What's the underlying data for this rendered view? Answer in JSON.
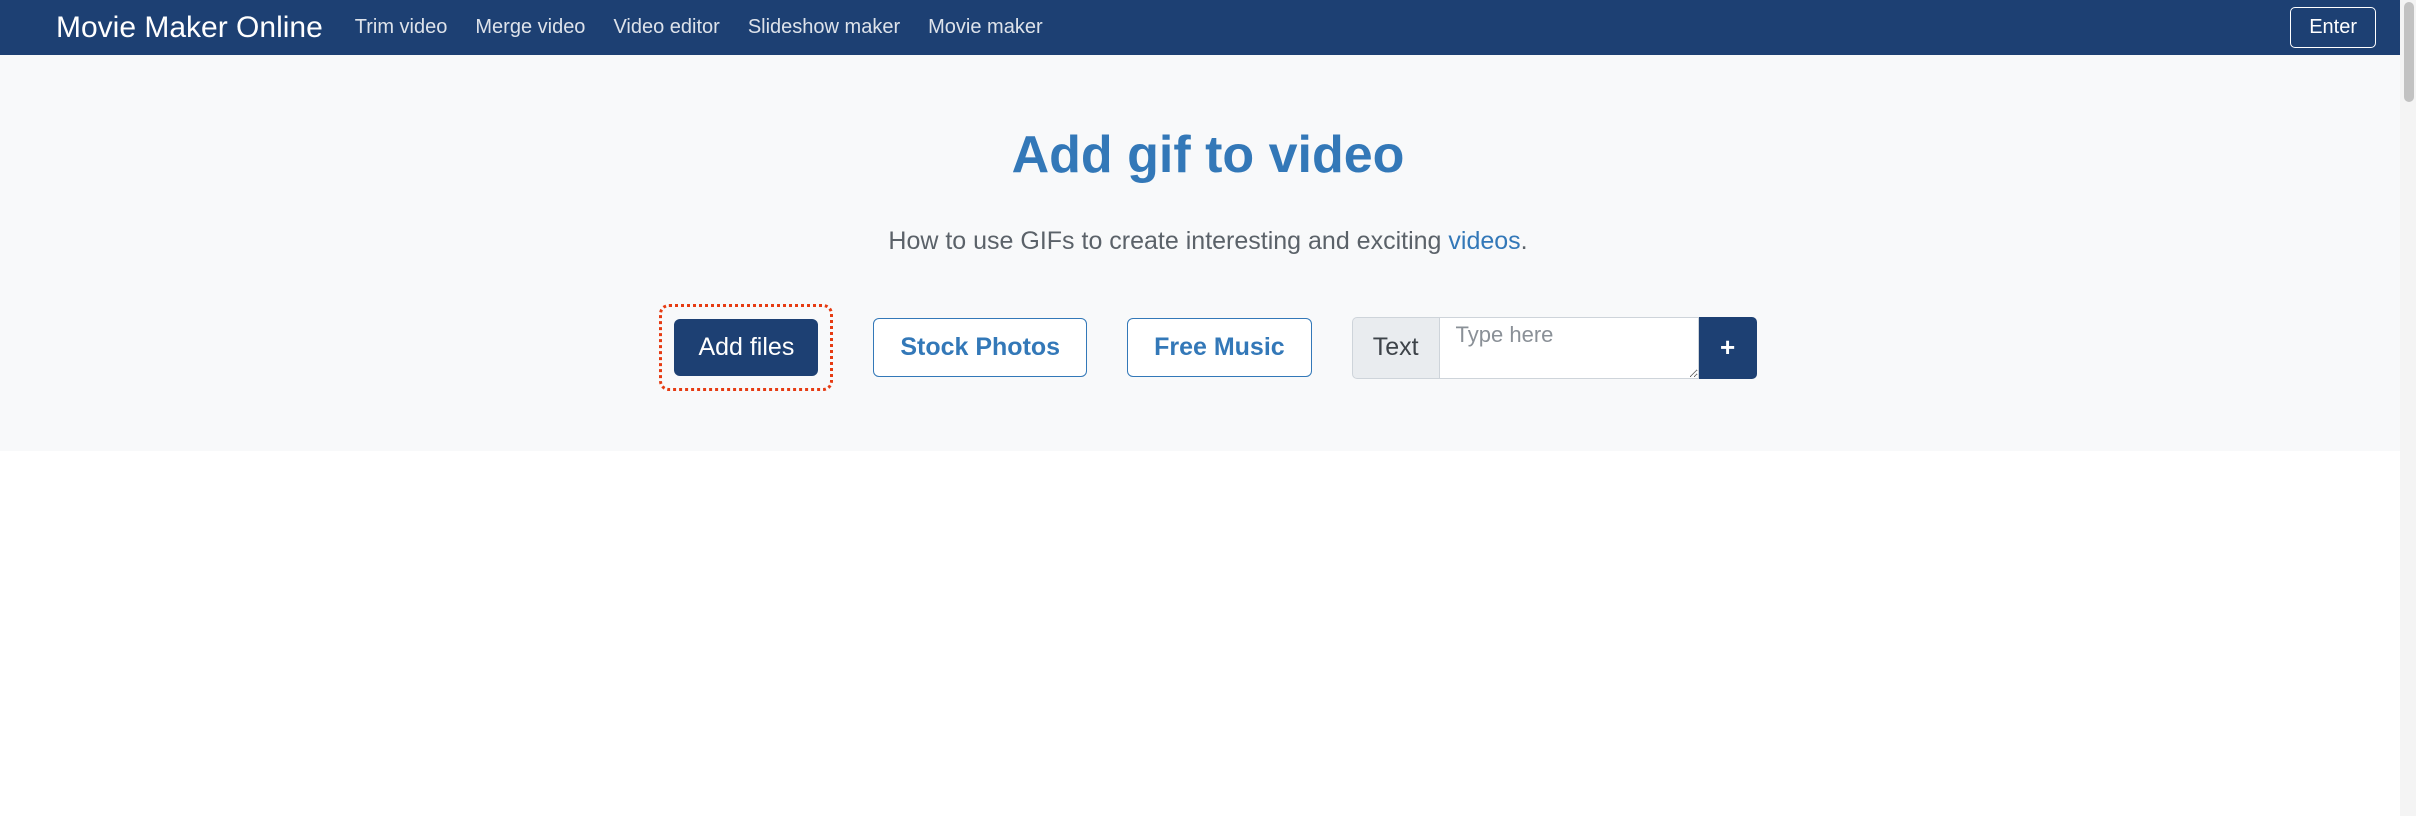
{
  "nav": {
    "brand": "Movie Maker Online",
    "links": {
      "trim": "Trim video",
      "merge": "Merge video",
      "editor": "Video editor",
      "slideshow": "Slideshow maker",
      "movie": "Movie maker"
    },
    "enter": "Enter"
  },
  "hero": {
    "title": "Add gif to video",
    "subtitle_prefix": "How to use GIFs to create interesting and exciting ",
    "subtitle_link": "videos",
    "subtitle_suffix": "."
  },
  "controls": {
    "add_files": "Add files",
    "stock_photos": "Stock Photos",
    "free_music": "Free Music",
    "text_label": "Text",
    "text_placeholder": "Type here",
    "plus": "+"
  }
}
